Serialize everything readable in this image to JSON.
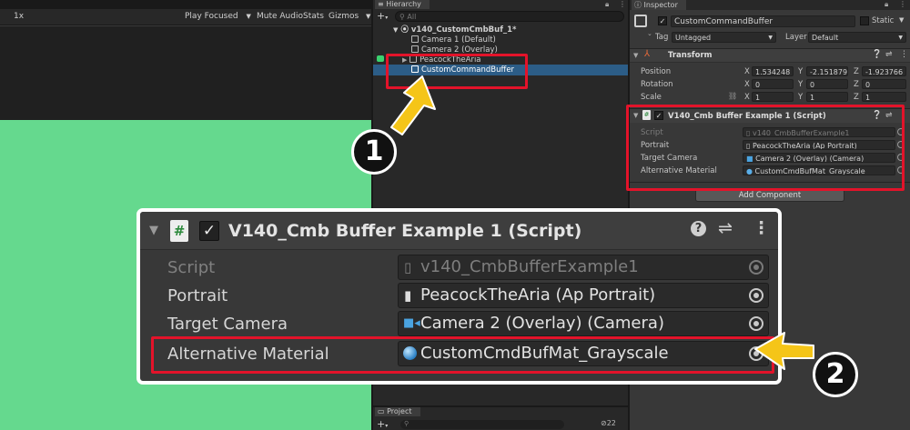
{
  "game_view": {
    "scale_label": "1x",
    "play_focused": "Play Focused",
    "mute_audio": "Mute Audio",
    "stats": "Stats",
    "gizmos": "Gizmos",
    "background_color": "#65d98e"
  },
  "hierarchy": {
    "title": "Hierarchy",
    "search_placeholder": "All",
    "scene_name": "v140_CustomCmbBuf_1*",
    "items": [
      {
        "label": "Camera 1 (Default)"
      },
      {
        "label": "Camera 2 (Overlay)"
      },
      {
        "label": "PeacockTheAria"
      },
      {
        "label": "CustomCommandBuffer"
      }
    ]
  },
  "project": {
    "title": "Project",
    "hidden_count": "22"
  },
  "inspector": {
    "title": "Inspector",
    "object_name": "CustomCommandBuffer",
    "static_label": "Static",
    "tag_label": "Tag",
    "tag_value": "Untagged",
    "layer_label": "Layer",
    "layer_value": "Default",
    "transform": {
      "title": "Transform",
      "rows": [
        {
          "label": "Position",
          "x": "1.534248",
          "y": "-2.151879",
          "z": "-1.923766"
        },
        {
          "label": "Rotation",
          "x": "0",
          "y": "0",
          "z": "0"
        },
        {
          "label": "Scale",
          "x": "1",
          "y": "1",
          "z": "1"
        }
      ]
    },
    "script_component": {
      "title": "V140_Cmb Buffer Example 1 (Script)",
      "rows": [
        {
          "label": "Script",
          "value": "v140_CmbBufferExample1"
        },
        {
          "label": "Portrait",
          "value": "PeacockTheAria (Ap Portrait)"
        },
        {
          "label": "Target Camera",
          "value": "Camera 2 (Overlay) (Camera)"
        },
        {
          "label": "Alternative Material",
          "value": "CustomCmdBufMat_Grayscale"
        }
      ]
    },
    "add_component": "Add Component"
  },
  "zoom": {
    "title": "V140_Cmb Buffer Example 1 (Script)",
    "rows": [
      {
        "label": "Script",
        "value": "v140_CmbBufferExample1"
      },
      {
        "label": "Portrait",
        "value": "PeacockTheAria (Ap Portrait)"
      },
      {
        "label": "Target Camera",
        "value": "Camera 2 (Overlay) (Camera)"
      },
      {
        "label": "Alternative Material",
        "value": "CustomCmdBufMat_Grayscale"
      }
    ]
  },
  "annotations": {
    "step1": "1",
    "step2": "2",
    "highlight_color": "#e3132a",
    "arrow_color": "#f5c518"
  }
}
